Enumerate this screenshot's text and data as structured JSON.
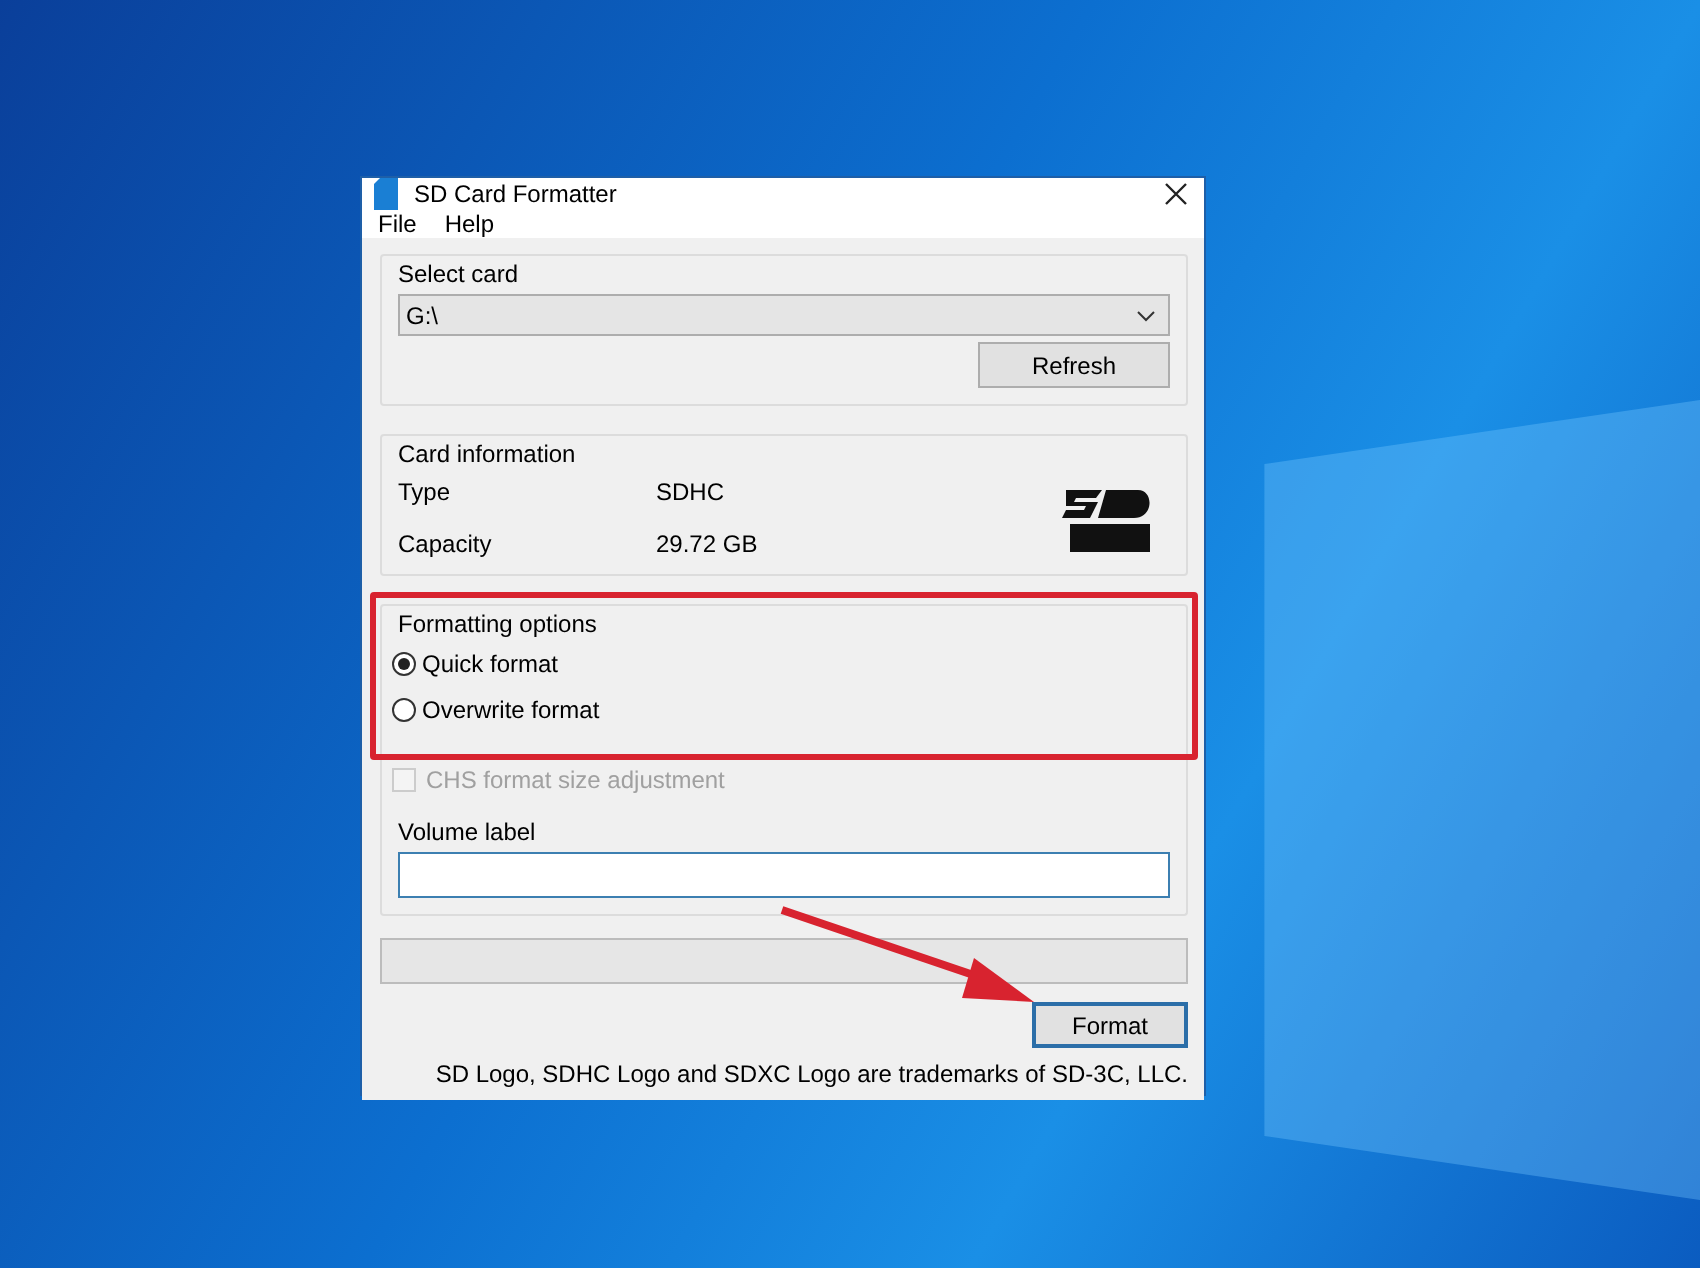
{
  "window": {
    "title": "SD Card Formatter"
  },
  "menu": [
    "File",
    "Help"
  ],
  "select_card": {
    "title": "Select card",
    "value": "G:\\",
    "refresh_button": "Refresh"
  },
  "card_information": {
    "title": "Card information",
    "rows": [
      {
        "label": "Type",
        "value": "SDHC"
      },
      {
        "label": "Capacity",
        "value": "29.72 GB"
      }
    ]
  },
  "formatting_options": {
    "title": "Formatting options",
    "highlighted": true,
    "options": [
      {
        "label": "Quick format",
        "selected": true
      },
      {
        "label": "Overwrite format",
        "selected": false
      }
    ]
  },
  "chs_adjustment": {
    "label": "CHS format size adjustment",
    "checked": false,
    "disabled": true
  },
  "volume_label": {
    "label": "Volume label"
  },
  "progress": {
    "level": 0
  },
  "format_button": "Format",
  "footer": "SD Logo, SDHC Logo and SDXC Logo are trademarks of SD-3C, LLC."
}
